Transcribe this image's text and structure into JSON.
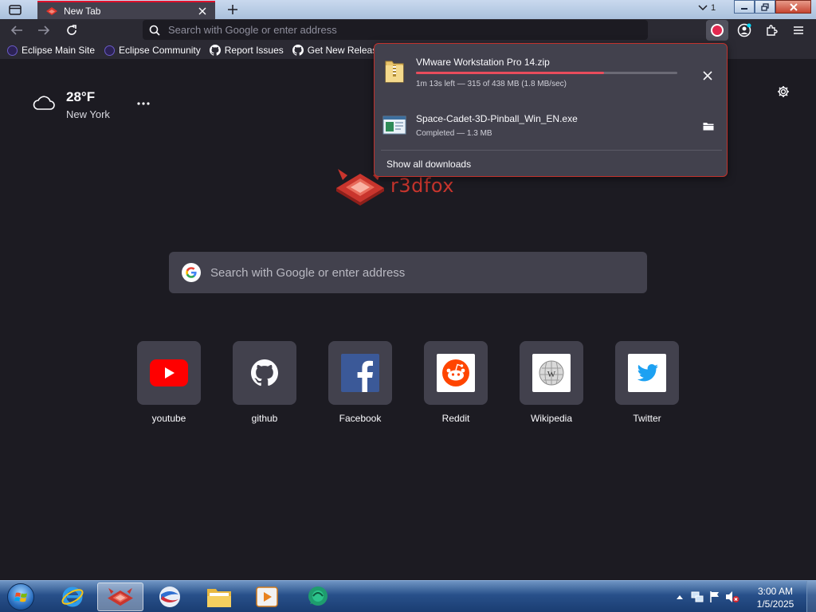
{
  "browser": {
    "tab": {
      "title": "New Tab"
    },
    "tab_count": "1",
    "urlbar": {
      "placeholder": "Search with Google or enter address"
    }
  },
  "bookmarks": [
    {
      "label": "Eclipse Main Site",
      "icon": "eclipse-icon"
    },
    {
      "label": "Eclipse Community",
      "icon": "eclipse-icon"
    },
    {
      "label": "Report Issues",
      "icon": "github-icon"
    },
    {
      "label": "Get New Releases",
      "icon": "github-icon"
    }
  ],
  "weather": {
    "temperature": "28°F",
    "location": "New York",
    "icon": "cloud-icon"
  },
  "logo": {
    "wordmark": "r3dfox"
  },
  "search": {
    "placeholder": "Search with Google or enter address"
  },
  "top_sites": [
    {
      "label": "youtube",
      "icon": "youtube-icon",
      "color": "#ff0000"
    },
    {
      "label": "github",
      "icon": "github-icon",
      "color": "#ffffff"
    },
    {
      "label": "Facebook",
      "icon": "facebook-icon",
      "color": "#3b5998"
    },
    {
      "label": "Reddit",
      "icon": "reddit-icon",
      "color": "#ff4500"
    },
    {
      "label": "Wikipedia",
      "icon": "wikipedia-icon",
      "color": "#ffffff"
    },
    {
      "label": "Twitter",
      "icon": "twitter-icon",
      "color": "#1da1f2"
    }
  ],
  "downloads": {
    "items": [
      {
        "name": "VMware Workstation Pro 14.zip",
        "status": "1m 13s left — 315 of 438 MB (1.8 MB/sec)",
        "progress": 0.719,
        "icon": "zip-folder-icon"
      },
      {
        "name": "Space-Cadet-3D-Pinball_Win_EN.exe",
        "status": "Completed — 1.3 MB",
        "icon": "exe-file-icon"
      }
    ],
    "show_all_label": "Show all downloads"
  },
  "taskbar": {
    "apps": [
      "internet-explorer-icon",
      "r3dfox-icon",
      "app-sphere-icon",
      "file-explorer-icon",
      "media-player-icon",
      "chat-app-icon"
    ],
    "clock": {
      "time": "3:00 AM",
      "date": "1/5/2025"
    }
  },
  "colors": {
    "accent": "#e0102a",
    "background": "#1c1b22",
    "panel": "#42414d",
    "progress": "#e94c5c"
  }
}
